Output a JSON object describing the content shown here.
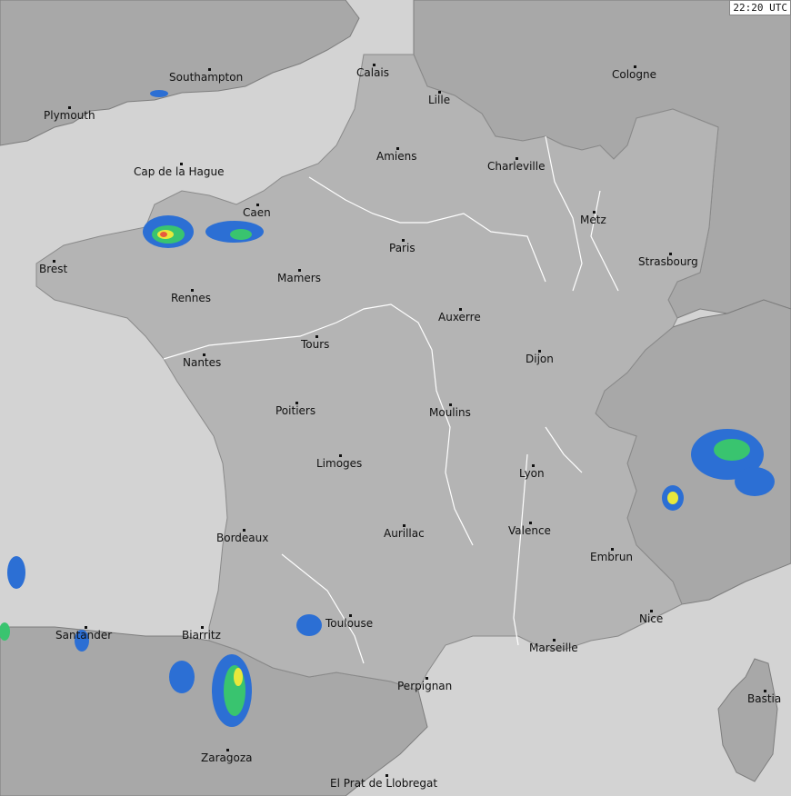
{
  "timestamp": "22:20 UTC",
  "cities": [
    {
      "id": "southampton",
      "name": "Southampton"
    },
    {
      "id": "plymouth",
      "name": "Plymouth"
    },
    {
      "id": "calais",
      "name": "Calais"
    },
    {
      "id": "cologne",
      "name": "Cologne"
    },
    {
      "id": "lille",
      "name": "Lille"
    },
    {
      "id": "cap-de-la-hague",
      "name": "Cap de la Hague"
    },
    {
      "id": "amiens",
      "name": "Amiens"
    },
    {
      "id": "charleville",
      "name": "Charleville"
    },
    {
      "id": "caen",
      "name": "Caen"
    },
    {
      "id": "metz",
      "name": "Metz"
    },
    {
      "id": "paris",
      "name": "Paris"
    },
    {
      "id": "brest",
      "name": "Brest"
    },
    {
      "id": "strasbourg",
      "name": "Strasbourg"
    },
    {
      "id": "mamers",
      "name": "Mamers"
    },
    {
      "id": "rennes",
      "name": "Rennes"
    },
    {
      "id": "auxerre",
      "name": "Auxerre"
    },
    {
      "id": "tours",
      "name": "Tours"
    },
    {
      "id": "nantes",
      "name": "Nantes"
    },
    {
      "id": "dijon",
      "name": "Dijon"
    },
    {
      "id": "poitiers",
      "name": "Poitiers"
    },
    {
      "id": "moulins",
      "name": "Moulins"
    },
    {
      "id": "limoges",
      "name": "Limoges"
    },
    {
      "id": "lyon",
      "name": "Lyon"
    },
    {
      "id": "valence",
      "name": "Valence"
    },
    {
      "id": "bordeaux",
      "name": "Bordeaux"
    },
    {
      "id": "aurillac",
      "name": "Aurillac"
    },
    {
      "id": "embrun",
      "name": "Embrun"
    },
    {
      "id": "toulouse",
      "name": "Toulouse"
    },
    {
      "id": "nice",
      "name": "Nice"
    },
    {
      "id": "santander",
      "name": "Santander"
    },
    {
      "id": "biarritz",
      "name": "Biarritz"
    },
    {
      "id": "marseille",
      "name": "Marseille"
    },
    {
      "id": "perpignan",
      "name": "Perpignan"
    },
    {
      "id": "bastia",
      "name": "Bastia"
    },
    {
      "id": "zaragoza",
      "name": "Zaragoza"
    },
    {
      "id": "el-prat",
      "name": "El Prat de Llobregat"
    }
  ]
}
